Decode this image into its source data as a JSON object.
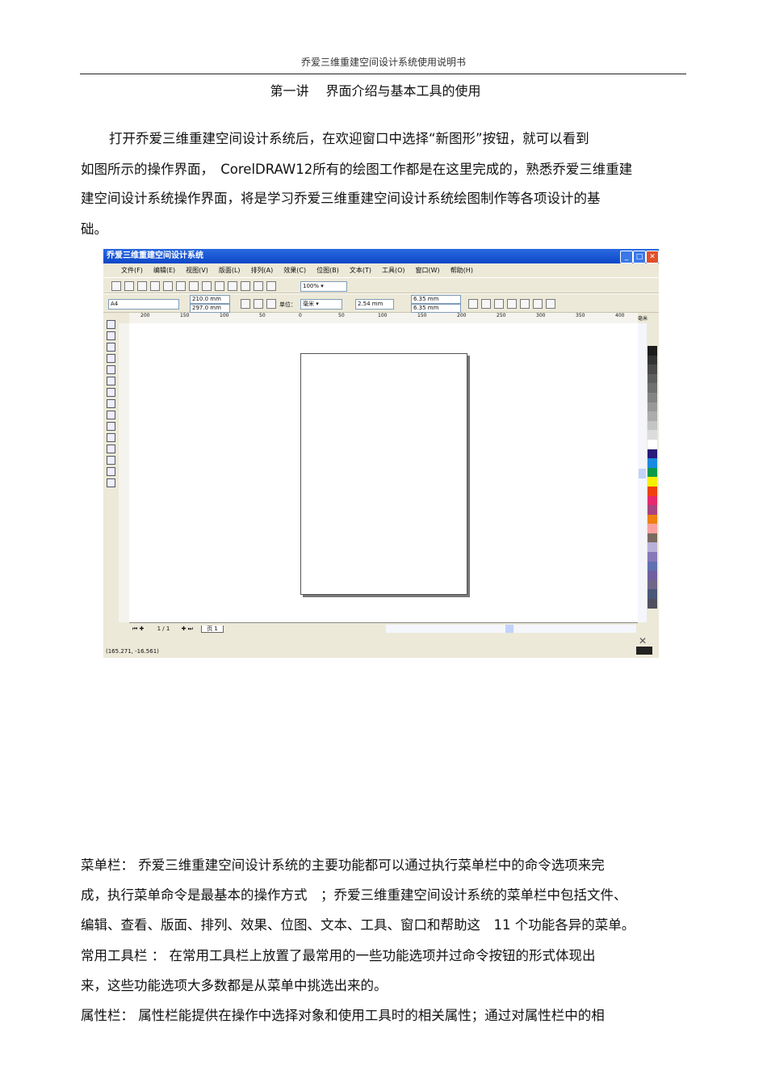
{
  "header": "乔爱三维重建空间设计系统使用说明书",
  "title": "第一讲　 界面介绍与基本工具的使用",
  "intro": [
    "打开乔爱三维重建空间设计系统后，在欢迎窗口中选择“新图形”按钮，就可以看到",
    "如图所示的操作界面，　CorelDRAW12所有的绘图工作都是在这里完成的，熟悉乔爱三维重建",
    "建空间设计系统操作界面，将是学习乔爱三维重建空间设计系统绘图制作等各项设计的基",
    "础。"
  ],
  "app": {
    "title": "乔爱三维重建空间设计系统",
    "menu": [
      "文件(F)",
      "编辑(E)",
      "视图(V)",
      "版面(L)",
      "排列(A)",
      "效果(C)",
      "位图(B)",
      "文本(T)",
      "工具(O)",
      "窗口(W)",
      "帮助(H)"
    ],
    "zoom": "100%",
    "paper": "A4",
    "width": "210.0 mm",
    "height": "297.0 mm",
    "unit_label": "单位：",
    "unit": "毫米",
    "nudge": "2.54 mm",
    "dup_x": "6.35 mm",
    "dup_y": "6.35 mm",
    "ruler_ticks": [
      "200",
      "150",
      "100",
      "50",
      "0",
      "50",
      "100",
      "150",
      "200",
      "250",
      "300",
      "350",
      "400"
    ],
    "ruler_unit": "毫米",
    "page_count": "1 / 1",
    "page_tab": "页 1",
    "status_coords": "(165.271, -16.561)",
    "palette": [
      "#1c1c1c",
      "#333333",
      "#4a4a4a",
      "#5e5e5e",
      "#707070",
      "#848484",
      "#989898",
      "#acacac",
      "#c4c4c4",
      "#dcdcdc",
      "#ffffff",
      "#2a1a7a",
      "#1a8ae0",
      "#0a9a4a",
      "#f4f000",
      "#f04010",
      "#e8286e",
      "#a84480",
      "#f08010",
      "#f8a0a0",
      "#7a6a60",
      "#b8b0d8",
      "#8878b8",
      "#6070b0",
      "#7060a0",
      "#706888",
      "#485878",
      "#505060"
    ]
  },
  "body": [
    "菜单栏： 乔爱三维重建空间设计系统的主要功能都可以通过执行菜单栏中的命令选项来完",
    "成，执行菜单命令是最基本的操作方式　；乔爱三维重建空间设计系统的菜单栏中包括文件、",
    "编辑、查看、版面、排列、效果、位图、文本、工具、窗口和帮助这　11 个功能各异的菜单。",
    "常用工具栏 ： 在常用工具栏上放置了最常用的一些功能选项并过命令按钮的形式体现出",
    "来，这些功能选项大多数都是从菜单中挑选出来的。",
    "属性栏： 属性栏能提供在操作中选择对象和使用工具时的相关属性；通过对属性栏中的相"
  ]
}
